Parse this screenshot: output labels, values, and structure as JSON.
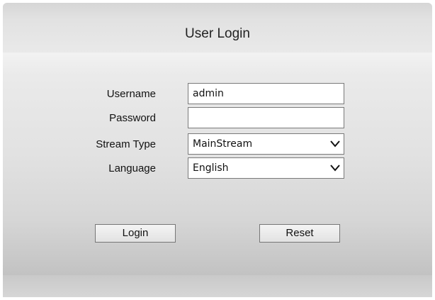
{
  "header": {
    "title": "User Login"
  },
  "form": {
    "username": {
      "label": "Username",
      "value": "admin"
    },
    "password": {
      "label": "Password",
      "value": ""
    },
    "stream_type": {
      "label": "Stream Type",
      "selected": "MainStream",
      "icon": "chevron-down-icon"
    },
    "language": {
      "label": "Language",
      "selected": "English",
      "icon": "chevron-down-icon"
    }
  },
  "buttons": {
    "login_label": "Login",
    "reset_label": "Reset"
  }
}
